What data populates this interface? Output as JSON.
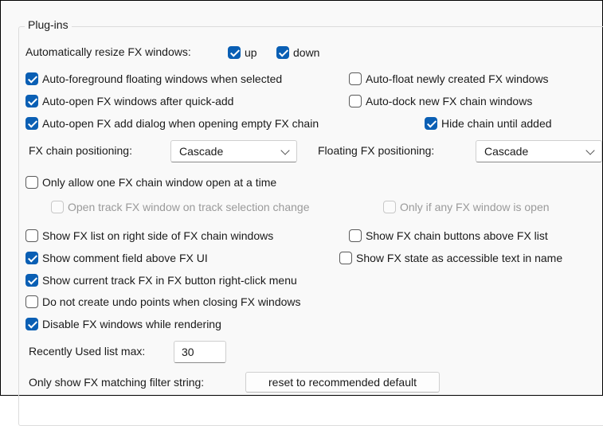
{
  "group": {
    "title": "Plug-ins"
  },
  "resize": {
    "label": "Automatically resize FX windows:",
    "up_label": "up",
    "up_checked": true,
    "down_label": "down",
    "down_checked": true
  },
  "options": {
    "auto_foreground": {
      "label": "Auto-foreground floating windows when selected",
      "checked": true
    },
    "auto_float": {
      "label": "Auto-float newly created FX windows",
      "checked": false
    },
    "auto_open_quick_add": {
      "label": "Auto-open FX windows after quick-add",
      "checked": true
    },
    "auto_dock": {
      "label": "Auto-dock new FX chain windows",
      "checked": false
    },
    "auto_open_add_dialog": {
      "label": "Auto-open FX add dialog when opening empty FX chain",
      "checked": true
    },
    "hide_chain": {
      "label": "Hide chain until added",
      "checked": true
    },
    "only_one_chain": {
      "label": "Only allow one FX chain window open at a time",
      "checked": false
    },
    "open_track_fx": {
      "label": "Open track FX window on track selection change",
      "checked": false,
      "disabled": true
    },
    "only_if_open": {
      "label": "Only if any FX window is open",
      "checked": false,
      "disabled": true
    },
    "fx_list_right": {
      "label": "Show FX list on right side of FX chain windows",
      "checked": false
    },
    "chain_buttons_above": {
      "label": "Show FX chain buttons above FX list",
      "checked": false
    },
    "comment_field": {
      "label": "Show comment field above FX UI",
      "checked": true
    },
    "fx_state_accessible": {
      "label": "Show FX state as accessible text in name",
      "checked": false
    },
    "current_track_menu": {
      "label": "Show current track FX in FX button right-click menu",
      "checked": true
    },
    "no_undo_points": {
      "label": "Do not create undo points when closing FX windows",
      "checked": false
    },
    "disable_while_rendering": {
      "label": "Disable FX windows while rendering",
      "checked": true
    }
  },
  "positioning": {
    "chain_label": "FX chain positioning:",
    "chain_value": "Cascade",
    "floating_label": "Floating FX positioning:",
    "floating_value": "Cascade"
  },
  "recent": {
    "label": "Recently Used list max:",
    "value": "30"
  },
  "filter": {
    "label": "Only show FX matching filter string:",
    "button_label": "reset to recommended default"
  },
  "colors": {
    "accent": "#0a5fb4",
    "disabled_text": "#9a9a9a",
    "panel_bg": "#f9f9f9"
  }
}
